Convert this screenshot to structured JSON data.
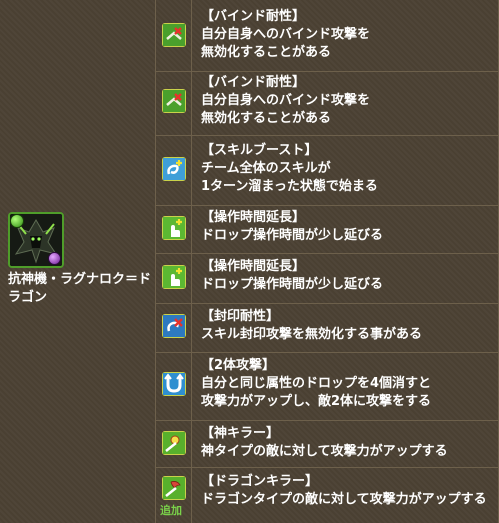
{
  "monster": {
    "name_line1": "抗神機・ラグナロク＝ド",
    "name_line2": "ラゴン",
    "attribute_badge": "dark-orb-icon",
    "subattribute_badge": "wood-orb-icon"
  },
  "awakenings": [
    {
      "icon": "bind-resist-icon",
      "lines": [
        "【バインド耐性】",
        "自分自身へのバインド攻撃を",
        "無効化することがある"
      ]
    },
    {
      "icon": "bind-resist-icon",
      "lines": [
        "【バインド耐性】",
        "自分自身へのバインド攻撃を",
        "無効化することがある"
      ]
    },
    {
      "icon": "skill-boost-icon",
      "lines": [
        "【スキルブースト】",
        "チーム全体のスキルが",
        "1ターン溜まった状態で始まる"
      ]
    },
    {
      "icon": "time-extend-icon",
      "lines": [
        "【操作時間延長】",
        "ドロップ操作時間が少し延びる"
      ]
    },
    {
      "icon": "time-extend-icon",
      "lines": [
        "【操作時間延長】",
        "ドロップ操作時間が少し延びる"
      ]
    },
    {
      "icon": "seal-resist-icon",
      "lines": [
        "【封印耐性】",
        "スキル封印攻撃を無効化する事がある"
      ]
    },
    {
      "icon": "two-pronged-icon",
      "lines": [
        "【2体攻撃】",
        "自分と同じ属性のドロップを4個消すと",
        "攻撃力がアップし、敵2体に攻撃をする"
      ]
    },
    {
      "icon": "god-killer-icon",
      "lines": [
        "【神キラー】",
        "神タイプの敵に対して攻撃力がアップする"
      ]
    },
    {
      "icon": "dragon-killer-icon",
      "lines": [
        "【ドラゴンキラー】",
        "ドラゴンタイプの敵に対して攻撃力がアップする"
      ],
      "tag": "追加"
    }
  ],
  "colors": {
    "background": "#4b4133",
    "grid": "#6d604b",
    "text": "#ffffff",
    "extra_tag": "#7ad14a"
  }
}
